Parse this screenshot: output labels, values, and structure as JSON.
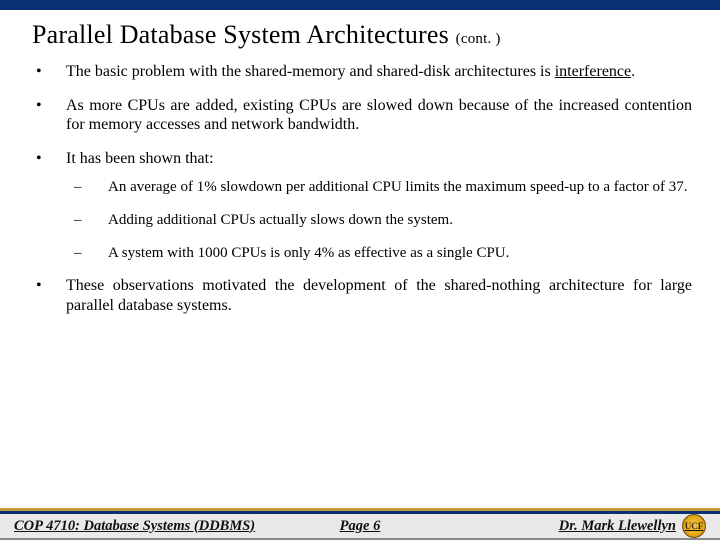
{
  "title": {
    "main": "Parallel Database System Architectures",
    "suffix": "(cont. )"
  },
  "bullets": {
    "b1_pre": "The basic problem with the shared-memory and shared-disk architectures is ",
    "b1_key": "interference",
    "b1_post": ".",
    "b2": "As more CPUs are added, existing CPUs are slowed down because of the increased contention for memory accesses and network bandwidth.",
    "b3": "It has been shown that:",
    "b3a": "An average of 1% slowdown per additional CPU limits the maximum speed-up to a factor of 37.",
    "b3b": "Adding additional CPUs actually slows down the system.",
    "b3c": "A system with 1000 CPUs is only 4% as effective as a single CPU.",
    "b4": "These observations motivated the development of the shared-nothing architecture for large parallel database systems."
  },
  "footer": {
    "left": "COP 4710: Database Systems  (DDBMS)",
    "center": "Page 6",
    "right": "Dr. Mark Llewellyn"
  }
}
